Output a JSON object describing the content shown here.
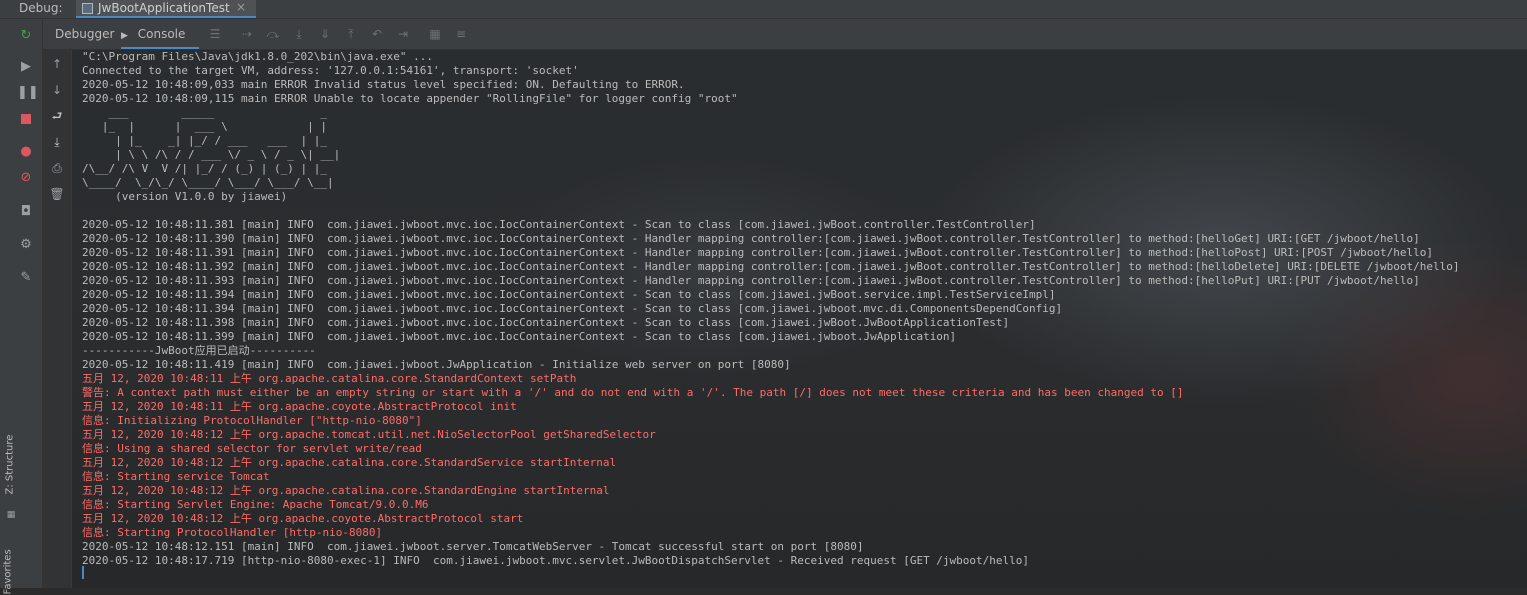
{
  "topbar": {
    "debug_label": "Debug:",
    "run_tab": "JwBootApplicationTest",
    "close_glyph": "×"
  },
  "toolbar": {
    "debugger_tab": "Debugger",
    "console_tab": "Console"
  },
  "side_panels": {
    "structure": "Z: Structure",
    "favorites": "Favorites"
  },
  "colors": {
    "accent": "#4a88c7",
    "error_text": "#ff6b68",
    "console_text": "#bbbbbb",
    "rerun_green": "#499c54",
    "stop_red": "#db5860"
  },
  "icons": {
    "rerun": "rerun-icon",
    "resume": "resume-icon",
    "pause": "pause-icon",
    "stop": "stop-icon",
    "view_breakpoints": "view-breakpoints-icon",
    "mute_breakpoints": "mute-breakpoints-icon",
    "camera": "camera-icon",
    "settings": "gear-icon",
    "pin": "pin-icon"
  },
  "console": {
    "lines": [
      {
        "text": "\"C:\\Program Files\\Java\\jdk1.8.0_202\\bin\\java.exe\" ...",
        "type": "normal"
      },
      {
        "text": "Connected to the target VM, address: '127.0.0.1:54161', transport: 'socket'",
        "type": "normal"
      },
      {
        "text": "2020-05-12 10:48:09,033 main ERROR Invalid status level specified: ON. Defaulting to ERROR.",
        "type": "normal"
      },
      {
        "text": "2020-05-12 10:48:09,115 main ERROR Unable to locate appender \"RollingFile\" for logger config \"root\"",
        "type": "normal"
      },
      {
        "text": "    ___        _____                _",
        "type": "banner"
      },
      {
        "text": "   |_  |      |  ___ \\            | |",
        "type": "banner"
      },
      {
        "text": "     | |_    _| |_/ / ___   ___  | |_",
        "type": "banner"
      },
      {
        "text": "     | \\ \\ /\\ / / ___ \\/ _ \\ / _ \\| __|",
        "type": "banner"
      },
      {
        "text": "/\\__/ /\\ V  V /| |_/ / (_) | (_) | |_",
        "type": "banner"
      },
      {
        "text": "\\____/  \\_/\\_/ \\____/ \\___/ \\___/ \\__|",
        "type": "banner"
      },
      {
        "text": "     (version V1.0.0 by jiawei)",
        "type": "banner"
      },
      {
        "text": "",
        "type": "normal"
      },
      {
        "text": "2020-05-12 10:48:11.381 [main] INFO  com.jiawei.jwboot.mvc.ioc.IocContainerContext - Scan to class [com.jiawei.jwBoot.controller.TestController]",
        "type": "normal"
      },
      {
        "text": "2020-05-12 10:48:11.390 [main] INFO  com.jiawei.jwboot.mvc.ioc.IocContainerContext - Handler mapping controller:[com.jiawei.jwBoot.controller.TestController] to method:[helloGet] URI:[GET /jwboot/hello]",
        "type": "normal"
      },
      {
        "text": "2020-05-12 10:48:11.391 [main] INFO  com.jiawei.jwboot.mvc.ioc.IocContainerContext - Handler mapping controller:[com.jiawei.jwBoot.controller.TestController] to method:[helloPost] URI:[POST /jwboot/hello]",
        "type": "normal"
      },
      {
        "text": "2020-05-12 10:48:11.392 [main] INFO  com.jiawei.jwboot.mvc.ioc.IocContainerContext - Handler mapping controller:[com.jiawei.jwBoot.controller.TestController] to method:[helloDelete] URI:[DELETE /jwboot/hello]",
        "type": "normal"
      },
      {
        "text": "2020-05-12 10:48:11.393 [main] INFO  com.jiawei.jwboot.mvc.ioc.IocContainerContext - Handler mapping controller:[com.jiawei.jwBoot.controller.TestController] to method:[helloPut] URI:[PUT /jwboot/hello]",
        "type": "normal"
      },
      {
        "text": "2020-05-12 10:48:11.394 [main] INFO  com.jiawei.jwboot.mvc.ioc.IocContainerContext - Scan to class [com.jiawei.jwBoot.service.impl.TestServiceImpl]",
        "type": "normal"
      },
      {
        "text": "2020-05-12 10:48:11.394 [main] INFO  com.jiawei.jwboot.mvc.ioc.IocContainerContext - Scan to class [com.jiawei.jwboot.mvc.di.ComponentsDependConfig]",
        "type": "normal"
      },
      {
        "text": "2020-05-12 10:48:11.398 [main] INFO  com.jiawei.jwboot.mvc.ioc.IocContainerContext - Scan to class [com.jiawei.jwBoot.JwBootApplicationTest]",
        "type": "normal"
      },
      {
        "text": "2020-05-12 10:48:11.399 [main] INFO  com.jiawei.jwboot.mvc.ioc.IocContainerContext - Scan to class [com.jiawei.jwboot.JwApplication]",
        "type": "normal"
      },
      {
        "text": "-----------JwBoot应用已启动----------",
        "type": "normal"
      },
      {
        "text": "2020-05-12 10:48:11.419 [main] INFO  com.jiawei.jwboot.JwApplication - Initialize web server on port [8080]",
        "type": "normal"
      },
      {
        "text": "五月 12, 2020 10:48:11 上午 org.apache.catalina.core.StandardContext setPath",
        "type": "err"
      },
      {
        "text": "警告: A context path must either be an empty string or start with a '/' and do not end with a '/'. The path [/] does not meet these criteria and has been changed to []",
        "type": "err"
      },
      {
        "text": "五月 12, 2020 10:48:11 上午 org.apache.coyote.AbstractProtocol init",
        "type": "err"
      },
      {
        "text": "信息: Initializing ProtocolHandler [\"http-nio-8080\"]",
        "type": "err"
      },
      {
        "text": "五月 12, 2020 10:48:12 上午 org.apache.tomcat.util.net.NioSelectorPool getSharedSelector",
        "type": "err"
      },
      {
        "text": "信息: Using a shared selector for servlet write/read",
        "type": "err"
      },
      {
        "text": "五月 12, 2020 10:48:12 上午 org.apache.catalina.core.StandardService startInternal",
        "type": "err"
      },
      {
        "text": "信息: Starting service Tomcat",
        "type": "err"
      },
      {
        "text": "五月 12, 2020 10:48:12 上午 org.apache.catalina.core.StandardEngine startInternal",
        "type": "err"
      },
      {
        "text": "信息: Starting Servlet Engine: Apache Tomcat/9.0.0.M6",
        "type": "err"
      },
      {
        "text": "五月 12, 2020 10:48:12 上午 org.apache.coyote.AbstractProtocol start",
        "type": "err"
      },
      {
        "text": "信息: Starting ProtocolHandler [http-nio-8080]",
        "type": "err"
      },
      {
        "text": "2020-05-12 10:48:12.151 [main] INFO  com.jiawei.jwboot.server.TomcatWebServer - Tomcat successful start on port [8080]",
        "type": "normal"
      },
      {
        "text": "2020-05-12 10:48:17.719 [http-nio-8080-exec-1] INFO  com.jiawei.jwboot.mvc.servlet.JwBootDispatchServlet - Received request [GET /jwboot/hello]",
        "type": "normal"
      }
    ]
  }
}
